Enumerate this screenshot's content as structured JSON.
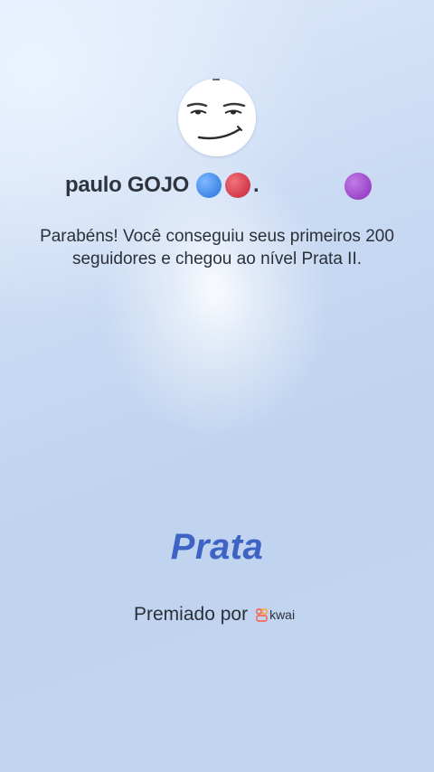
{
  "profile": {
    "username": "paulo GOJO",
    "name_suffix": ".",
    "avatar_icon": "meme-face-avatar",
    "badges": [
      {
        "name": "blue-circle-emoji",
        "color": "#3f86e6"
      },
      {
        "name": "red-circle-emoji",
        "color": "#d2394a"
      },
      {
        "name": "purple-circle-emoji",
        "color": "#9a44c8"
      }
    ]
  },
  "message": "Parabéns! Você conseguiu seus primeiros 200 seguidores e chegou ao nível Prata II.",
  "level": {
    "label": "Prata",
    "color": "#3f63c4"
  },
  "awarded": {
    "label": "Premiado por",
    "brand": "kwai",
    "brand_icon": "kwai-logo-icon",
    "brand_color": "#ff5a3c"
  }
}
